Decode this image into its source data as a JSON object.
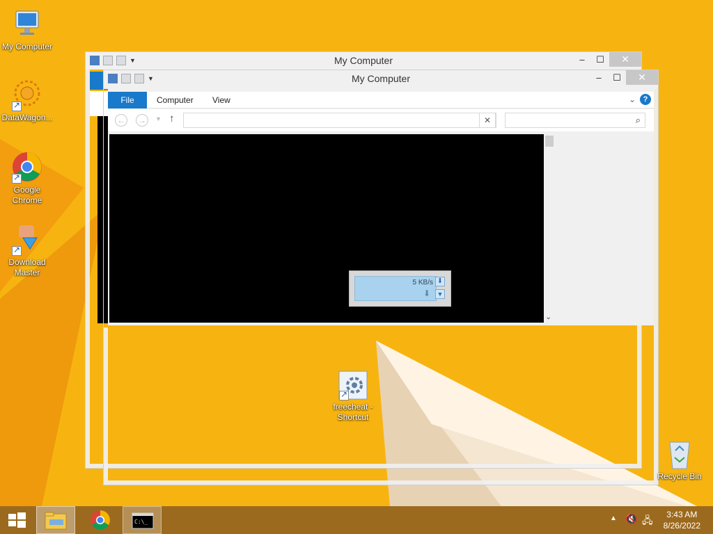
{
  "desktop": {
    "icons": [
      {
        "label": "My Computer"
      },
      {
        "label": "DataWagon..."
      },
      {
        "label": "Google Chrome"
      },
      {
        "label": "Download Master"
      },
      {
        "label": "freecheat - Shortcut"
      },
      {
        "label": "Recycle Bin"
      }
    ]
  },
  "back_window": {
    "title": "My Computer"
  },
  "front_window": {
    "title": "My Computer",
    "tabs": [
      {
        "label": "File"
      },
      {
        "label": "Computer"
      },
      {
        "label": "View"
      }
    ],
    "address_value": "",
    "search_placeholder": ""
  },
  "download_widget": {
    "speed": "5 KB/s"
  },
  "taskbar": {
    "clock_time": "3:43 AM",
    "clock_date": "8/26/2022"
  },
  "colors": {
    "wallpaper": "#f7b410",
    "accent": "#1979ca",
    "taskbar": "#9c6a1e"
  }
}
